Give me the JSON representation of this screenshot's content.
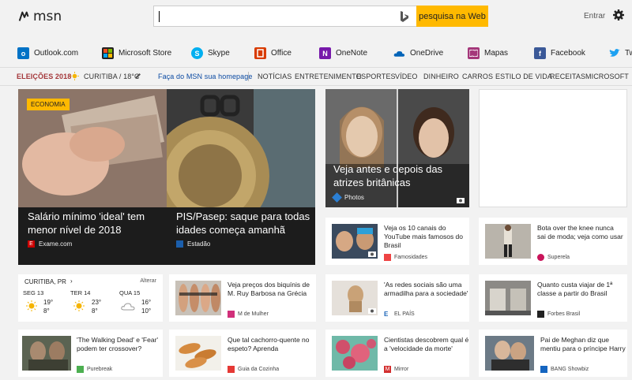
{
  "header": {
    "logo_text": "msn",
    "search": {
      "value": "",
      "placeholder": "",
      "button_label": "pesquisa na Web"
    },
    "signin_label": "Entrar"
  },
  "shortcuts": [
    {
      "label": "Outlook.com",
      "icon": "outlook-icon",
      "color": "#0072c6",
      "glyph": "o"
    },
    {
      "label": "Microsoft Store",
      "icon": "store-icon",
      "color": "#222222",
      "glyph": ""
    },
    {
      "label": "Skype",
      "icon": "skype-icon",
      "color": "#00aff0",
      "glyph": "S"
    },
    {
      "label": "Office",
      "icon": "office-icon",
      "color": "#d83b01",
      "glyph": ""
    },
    {
      "label": "OneNote",
      "icon": "onenote-icon",
      "color": "#7719aa",
      "glyph": "N"
    },
    {
      "label": "OneDrive",
      "icon": "onedrive-icon",
      "color": "#0364b8",
      "glyph": ""
    },
    {
      "label": "Mapas",
      "icon": "maps-icon",
      "color": "#a4377a",
      "glyph": ""
    },
    {
      "label": "Facebook",
      "icon": "facebook-icon",
      "color": "#3b5998",
      "glyph": "f"
    },
    {
      "label": "Tw",
      "icon": "twitter-icon",
      "color": "#1da1f2",
      "glyph": ""
    }
  ],
  "nav": {
    "elections": "ELEIÇÕES 2018",
    "weather": "CURITIBA / 18°C",
    "homepage": "Faça do MSN sua homepage",
    "items": [
      "NOTÍCIAS",
      "ENTRETENIMENTO",
      "ESPORTES",
      "VÍDEO",
      "DINHEIRO",
      "CARROS",
      "ESTILO DE VIDA",
      "RECEITAS",
      "MICROSOFT"
    ]
  },
  "heroes": [
    {
      "badge": "ECONOMIA",
      "title": "Salário mínimo 'ideal' tem menor nível de 2018",
      "source": "Exame.com"
    },
    {
      "title": "PIS/Pasep: saque para todas idades começa amanhã",
      "source": "Estadão"
    },
    {
      "title": "Veja antes e depois das atrizes britânicas",
      "source": "Photos"
    }
  ],
  "cards": [
    {
      "title": "Veja os 10 canais do YouTube mais famosos do Brasil",
      "source": "Famosidades"
    },
    {
      "title": "Bota over the knee nunca sai de moda; veja como usar",
      "source": "Superela"
    },
    {
      "title": "Veja preços dos biquínis de M. Ruy Barbosa na Grécia",
      "source": "M de Mulher"
    },
    {
      "title": "'As redes sociais são uma armadilha para a sociedade'",
      "source": "EL PAÍS"
    },
    {
      "title": "Quanto custa viajar de 1ª classe a partir do Brasil",
      "source": "Forbes Brasil"
    },
    {
      "title": "'The Walking Dead' e 'Fear' podem ter crossover?",
      "source": "Purebreak"
    },
    {
      "title": "Que tal cachorro-quente no espeto? Aprenda",
      "source": "Guia da Cozinha"
    },
    {
      "title": "Cientistas descobrem qual é a 'velocidade da morte'",
      "source": "Mirror"
    },
    {
      "title": "Pai de Meghan diz que mentiu para o príncipe Harry",
      "source": "BANG Showbiz"
    }
  ],
  "weather": {
    "city": "CURITIBA, PR",
    "change": "Alterar",
    "days": [
      {
        "day": "SEG 13",
        "high": "19°",
        "low": "8°",
        "icon": "sun-icon"
      },
      {
        "day": "TER 14",
        "high": "23°",
        "low": "8°",
        "icon": "sun-icon"
      },
      {
        "day": "QUA 15",
        "high": "16°",
        "low": "10°",
        "icon": "cloud-icon"
      }
    ]
  },
  "colors": {
    "accent": "#ffb900",
    "elections": "#a4373a",
    "link": "#0b4aa2"
  }
}
